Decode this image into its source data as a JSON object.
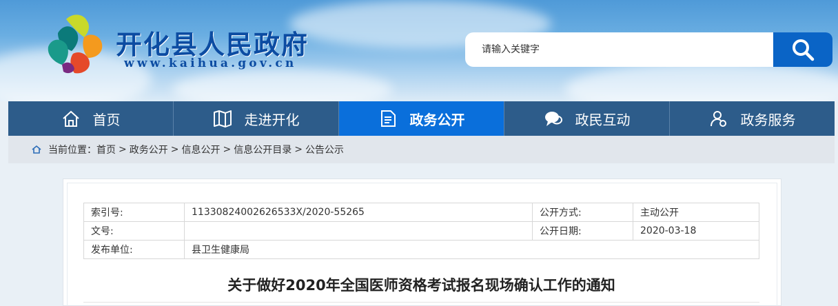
{
  "header": {
    "site_title": "开化县人民政府",
    "site_url": "www.kaihua.gov.cn",
    "logo_icon": "county-map-logo-icon"
  },
  "search": {
    "placeholder": "请输入关键字",
    "button_icon": "search-icon"
  },
  "nav": {
    "items": [
      {
        "label": "首页",
        "icon": "home-icon",
        "active": false
      },
      {
        "label": "走进开化",
        "icon": "map-icon",
        "active": false
      },
      {
        "label": "政务公开",
        "icon": "document-icon",
        "active": true
      },
      {
        "label": "政民互动",
        "icon": "chat-icon",
        "active": false
      },
      {
        "label": "政务服务",
        "icon": "person-service-icon",
        "active": false
      }
    ]
  },
  "breadcrumb": {
    "prefix": "当前位置：",
    "items": [
      "首页",
      "政务公开",
      "信息公开",
      "信息公开目录",
      "公告公示"
    ],
    "separator": ">"
  },
  "meta": {
    "index_label": "索引号:",
    "index_value": "11330824002626533X/2020-55265",
    "publicity_label": "公开方式:",
    "publicity_value": "主动公开",
    "doc_no_label": "文号:",
    "doc_no_value": "",
    "date_label": "公开日期:",
    "date_value": "2020-03-18",
    "publisher_label": "发布单位:",
    "publisher_value": "县卫生健康局"
  },
  "document": {
    "title": "关于做好2020年全国医师资格考试报名现场确认工作的通知"
  },
  "colors": {
    "nav_bg": "#2d5c8a",
    "nav_active": "#0a6fdb",
    "brand_blue": "#0c4ca2",
    "search_btn": "#0a64c6"
  }
}
